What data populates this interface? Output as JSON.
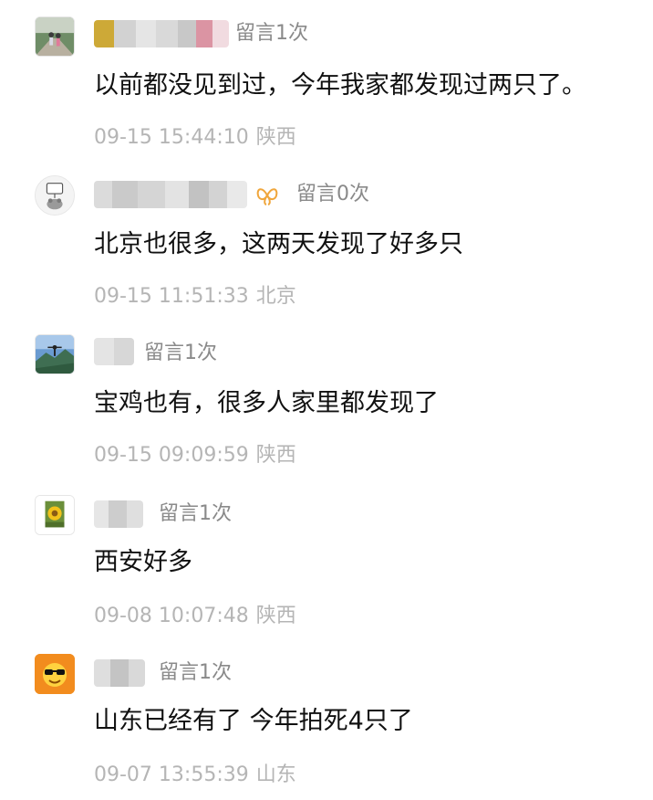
{
  "comments": [
    {
      "avatar_icon": "couple-walking-avatar",
      "reply_count": "留言1次",
      "content": "以前都没见到过，今年我家都发现过两只了。",
      "time": "09-15 15:44:10",
      "location": "陕西"
    },
    {
      "avatar_icon": "cartoon-sign-avatar",
      "badge_icon": "butterfly-icon",
      "reply_count": "留言0次",
      "content": "北京也很多，这两天发现了好多只",
      "time": "09-15 11:51:33",
      "location": "北京"
    },
    {
      "avatar_icon": "mountain-person-avatar",
      "reply_count": "留言1次",
      "content": "宝鸡也有，很多人家里都发现了",
      "time": "09-15 09:09:59",
      "location": "陕西"
    },
    {
      "avatar_icon": "sunflower-avatar",
      "reply_count": "留言1次",
      "content": "西安好多",
      "time": "09-08 10:07:48",
      "location": "陕西"
    },
    {
      "avatar_icon": "sunglasses-emoji-avatar",
      "reply_count": "留言1次",
      "content": "山东已经有了 今年拍死4只了",
      "time": "09-07 13:55:39",
      "location": "山东"
    }
  ],
  "colors": {
    "content_text": "#111111",
    "secondary_text": "#8a8a8a",
    "meta_text": "#b5b5b5",
    "badge_accent": "#f0a63c",
    "avatar_orange": "#f28c1e"
  }
}
